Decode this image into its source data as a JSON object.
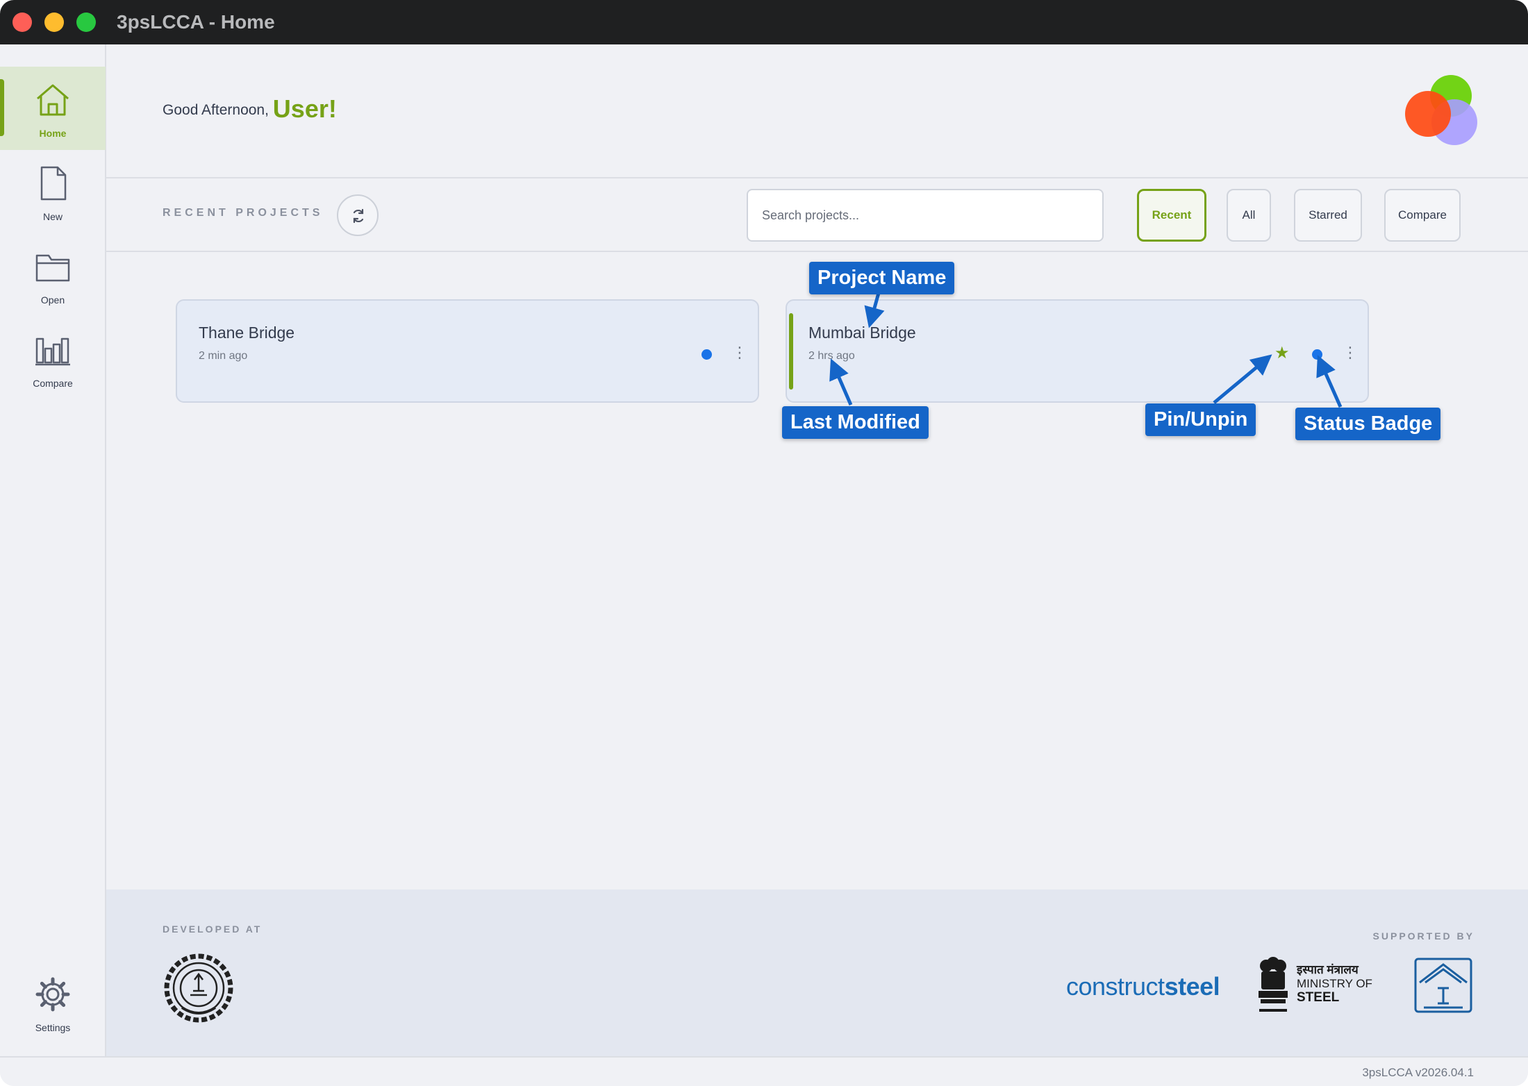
{
  "window": {
    "title": "3psLCCA - Home"
  },
  "sidebar": {
    "items": [
      {
        "label": "Home",
        "icon": "home-icon",
        "active": true
      },
      {
        "label": "New",
        "icon": "document-icon"
      },
      {
        "label": "Open",
        "icon": "folder-icon"
      },
      {
        "label": "Compare",
        "icon": "bar-chart-icon"
      }
    ],
    "settings_label": "Settings"
  },
  "header": {
    "greeting": "Good Afternoon,",
    "user_name": "User!"
  },
  "toolbar": {
    "section_label": "RECENT PROJECTS",
    "search_placeholder": "Search projects...",
    "filters": [
      {
        "label": "Recent",
        "active": true
      },
      {
        "label": "All"
      },
      {
        "label": "Starred"
      },
      {
        "label": "Compare"
      }
    ]
  },
  "projects": [
    {
      "name": "Thane Bridge",
      "modified": "2 min ago",
      "starred": false,
      "status_color": "#1a73e8"
    },
    {
      "name": "Mumbai Bridge",
      "modified": "2 hrs ago",
      "starred": true,
      "status_color": "#1a73e8"
    }
  ],
  "annotations": {
    "project_name": "Project Name",
    "last_modified": "Last Modified",
    "pin_unpin": "Pin/Unpin",
    "status_badge": "Status Badge"
  },
  "footer": {
    "developed_at": "DEVELOPED AT",
    "supported_by": "SUPPORTED BY",
    "construct": "construct",
    "steel": "steel",
    "ministry_hindi": "इस्पात मंत्रालय",
    "ministry_line1": "MINISTRY OF",
    "ministry_line2": "STEEL"
  },
  "statusbar": {
    "version": "3psLCCA v2026.04.1"
  },
  "colors": {
    "accent": "#76a217",
    "annotation": "#1565c8",
    "status": "#1a73e8"
  }
}
